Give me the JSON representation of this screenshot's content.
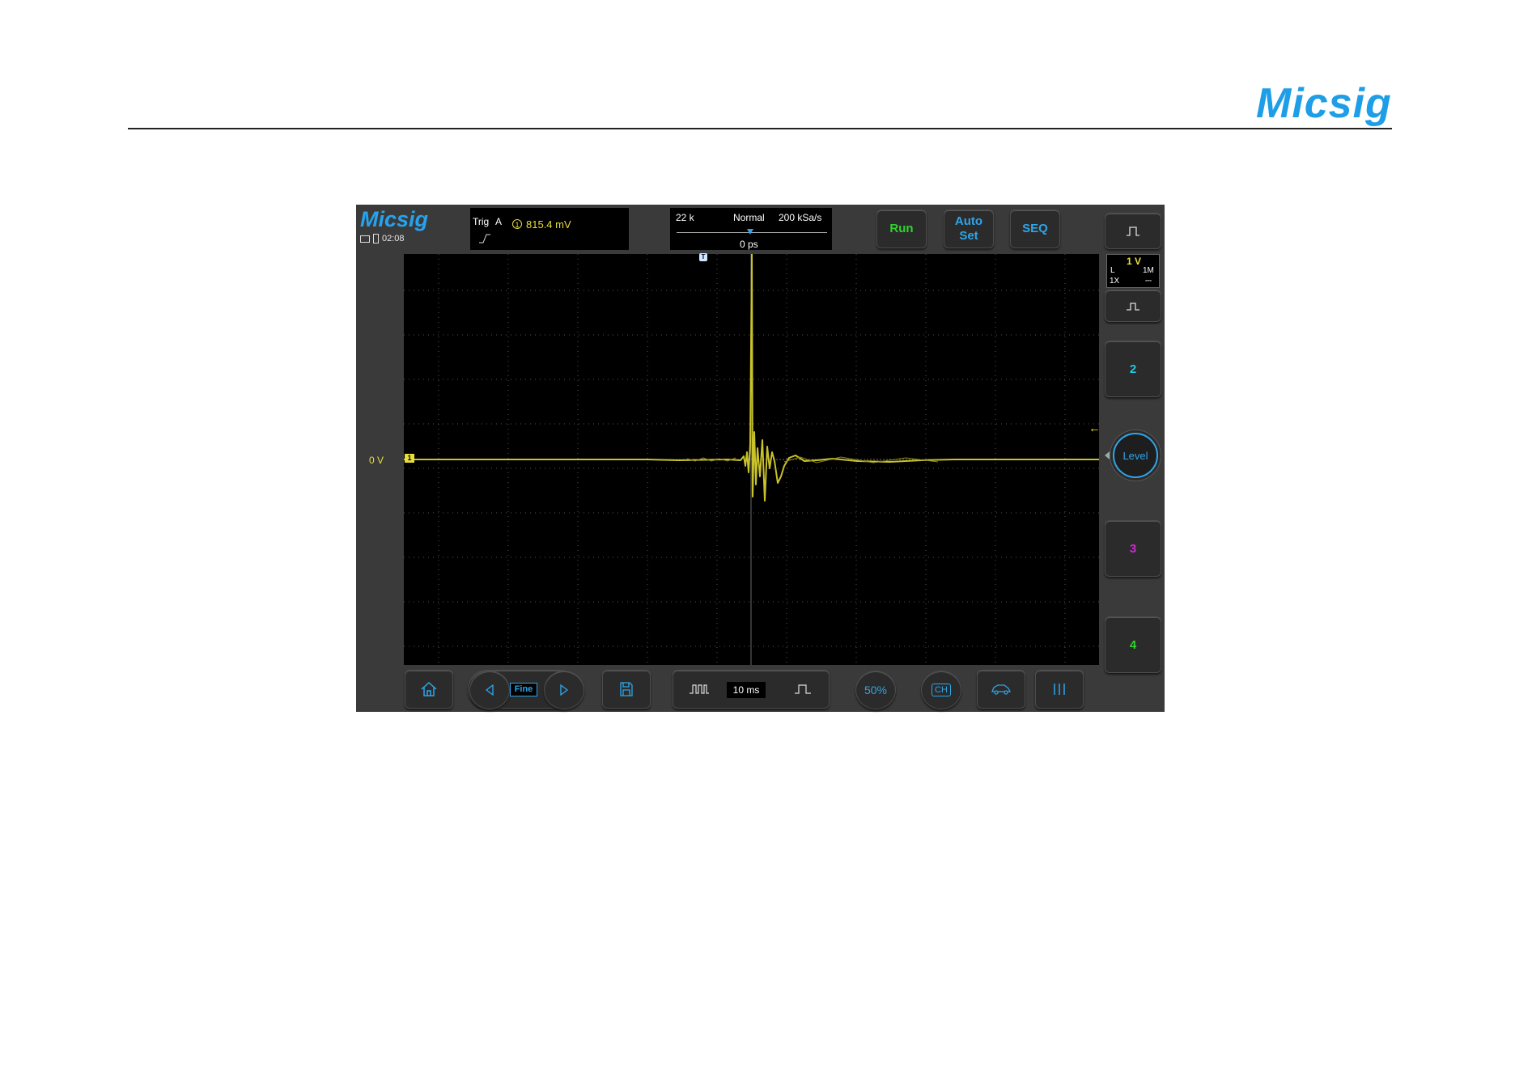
{
  "page": {
    "brand": "Micsig"
  },
  "app": {
    "logo": "Micsig",
    "time": "02:08"
  },
  "trigger": {
    "label": "Trig",
    "source": "A",
    "channel": "1",
    "level": "815.4  mV",
    "edge_icon": "rising-edge-icon"
  },
  "timebase_info": {
    "memory": "22 k",
    "mode": "Normal",
    "sample_rate": "200 kSa/s",
    "offset": "0 ps"
  },
  "top_buttons": {
    "run": "Run",
    "autoset_line1": "Auto",
    "autoset_line2": "Set",
    "seq": "SEQ"
  },
  "channel1": {
    "scale": "1 V",
    "coupling_l": "L",
    "impedance": "1M",
    "probe": "1X",
    "dc": "⎓",
    "zero_label": "0  V",
    "marker": "1"
  },
  "channels": {
    "ch2": "2",
    "ch3": "3",
    "ch4": "4"
  },
  "level_label": "Level",
  "bottom": {
    "fine": "Fine",
    "timebase": "10 ms",
    "fifty": "50%",
    "ch_label": "CH"
  },
  "colors": {
    "ch1": "#e8df3a",
    "ch2": "#22c8e0",
    "ch3": "#d02bd0",
    "ch4": "#2fd42f",
    "accent": "#2ea6ea",
    "run": "#2fd42f"
  }
}
